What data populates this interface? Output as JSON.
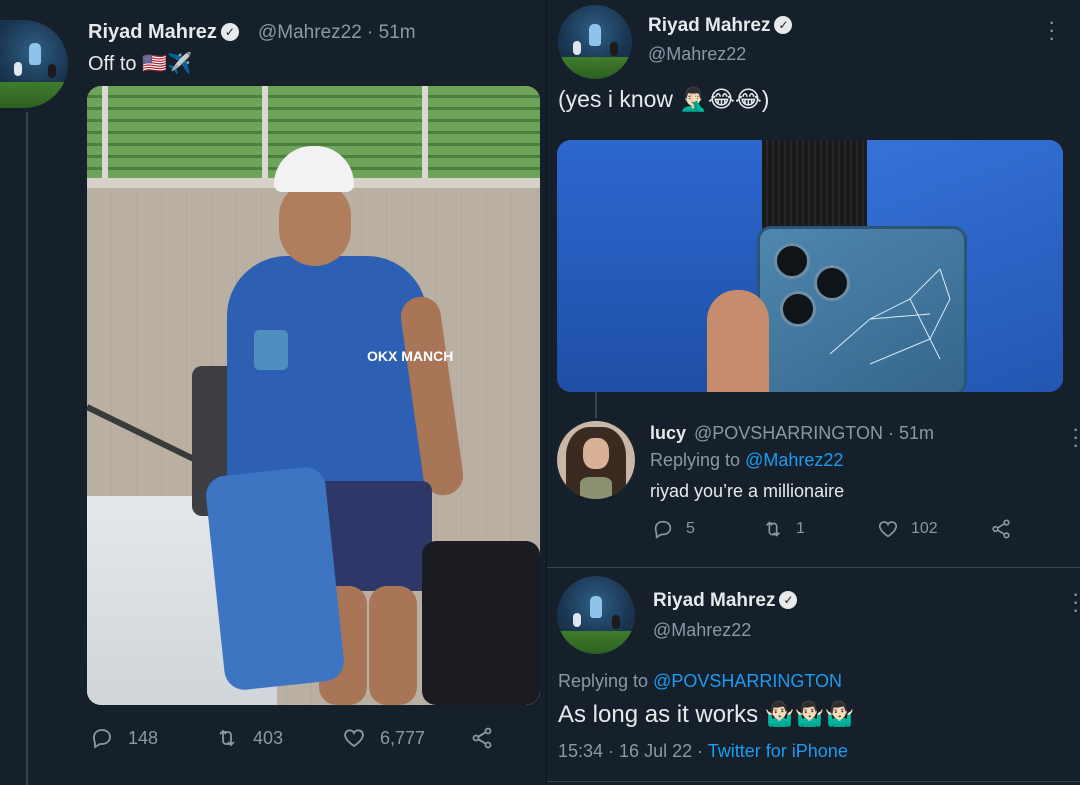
{
  "left_tweet": {
    "author_name": "Riyad Mahrez",
    "handle_time": "@Mahrez22 · 51m",
    "text": "Off to 🇺🇸✈️",
    "photo_caption": "OKX MANCH",
    "stats": {
      "replies": "148",
      "retweets": "403",
      "likes": "6,777"
    }
  },
  "right_tweet": {
    "author_name": "Riyad Mahrez",
    "handle": "@Mahrez22",
    "text": "(yes i know 🤦🏻‍♂️😂😂)"
  },
  "reply_1": {
    "author_name": "lucy",
    "handle_time": "@POVSHARRINGTON · 51m",
    "replying_label": "Replying to ",
    "replying_handle": "@Mahrez22",
    "text": "riyad you’re a millionaire",
    "stats": {
      "replies": "5",
      "retweets": "1",
      "likes": "102"
    }
  },
  "reply_2": {
    "author_name": "Riyad Mahrez",
    "handle": "@Mahrez22",
    "replying_label": "Replying to ",
    "replying_handle": "@POVSHARRINGTON",
    "text": "As long as it works 🤷🏻‍♂️🤷🏻‍♂️🤷🏻‍♂️",
    "timestamp": "15:34 · 16 Jul 22 · ",
    "client": "Twitter for iPhone"
  },
  "colors": {
    "background": "#15202b",
    "text": "#e7e9ea",
    "muted": "#8b98a5",
    "link": "#1d9bf0"
  }
}
